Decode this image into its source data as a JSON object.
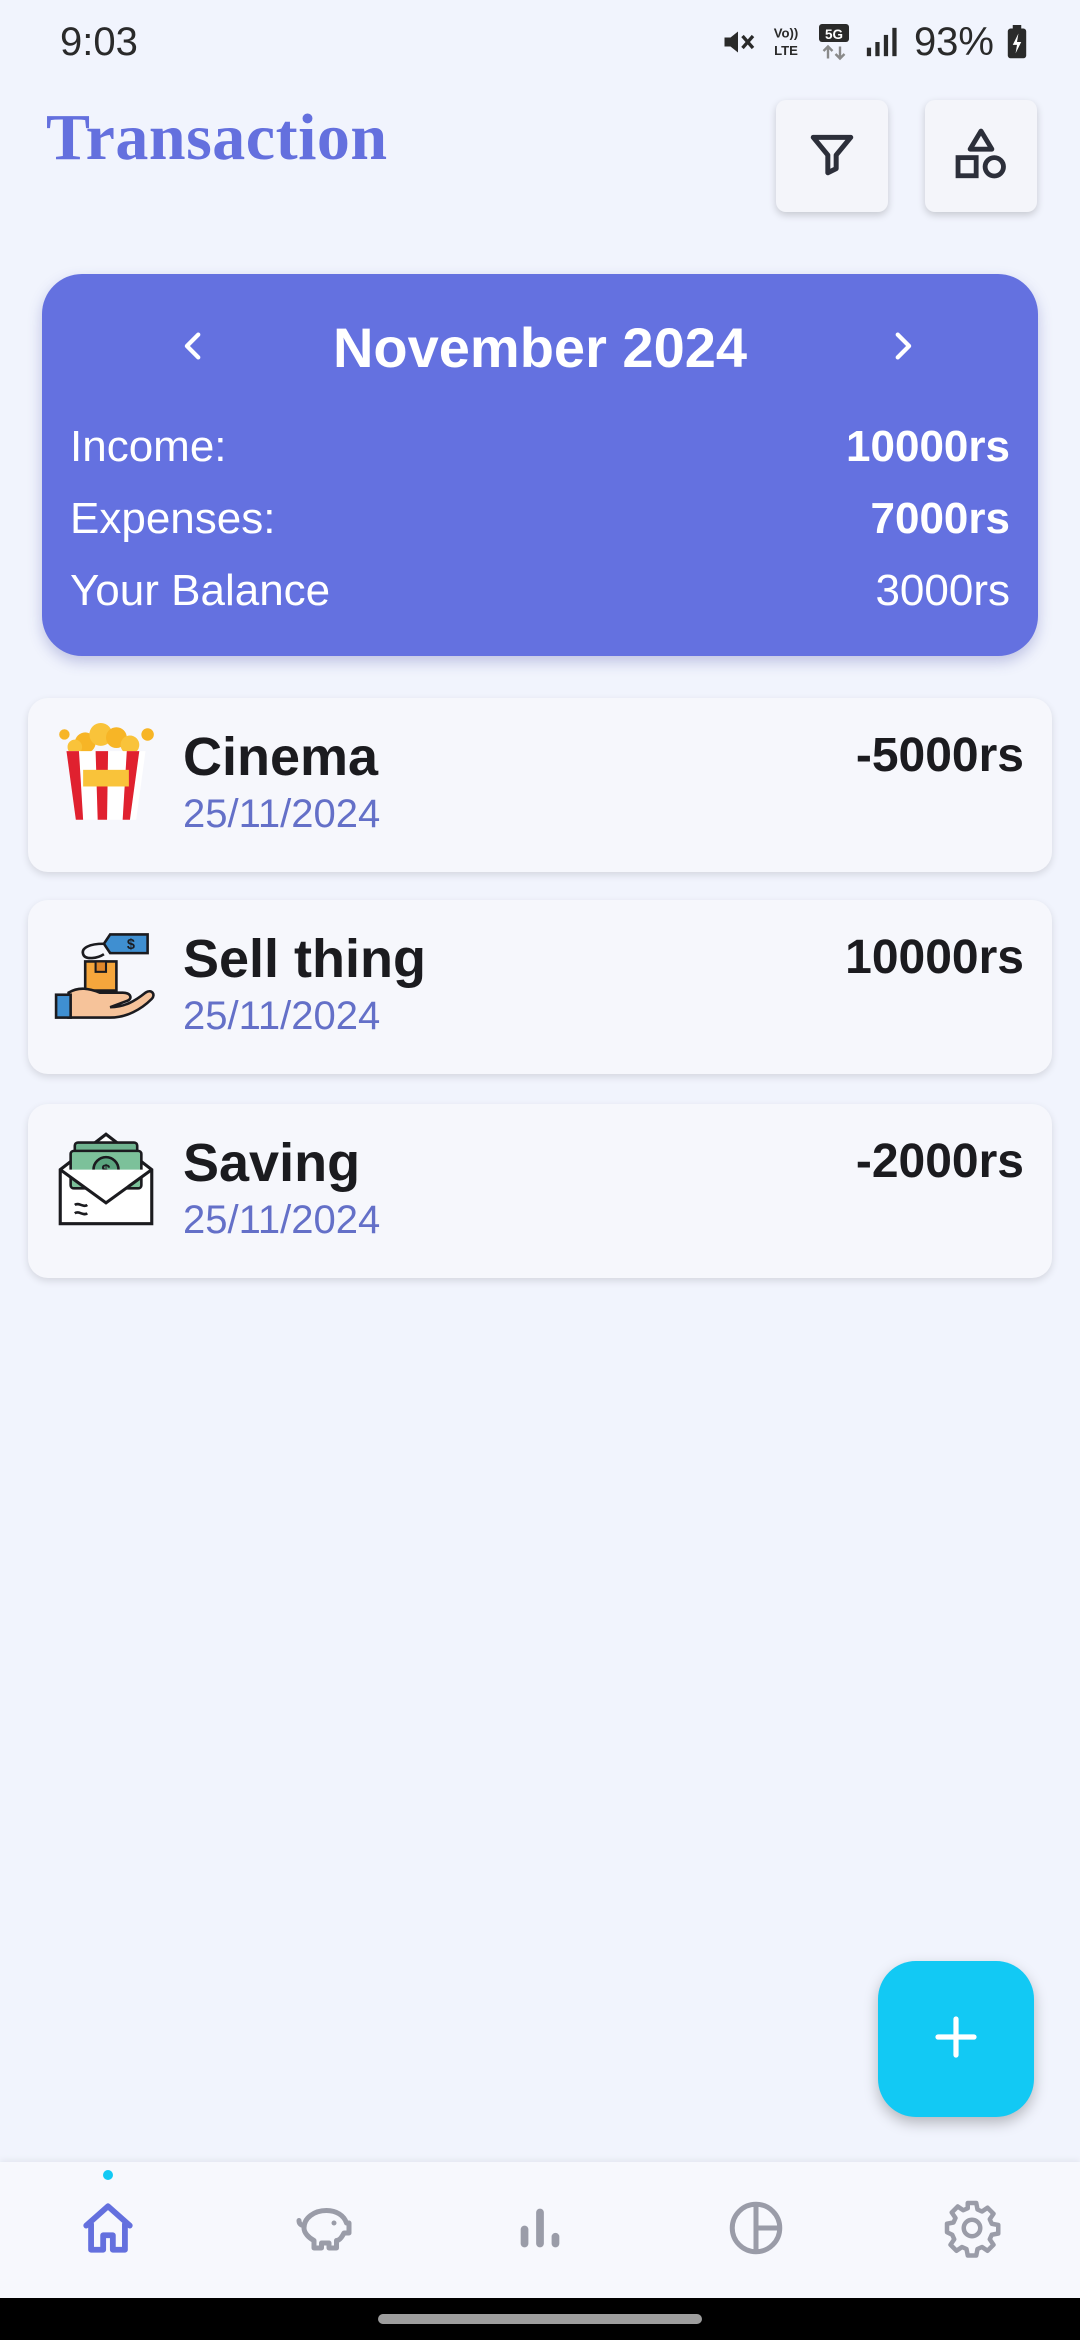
{
  "status_bar": {
    "time": "9:03",
    "battery": "93%",
    "icons": [
      "mute-icon",
      "volte-icon",
      "5g-icon",
      "signal-icon",
      "battery-icon"
    ]
  },
  "header": {
    "title": "Transaction",
    "filter_icon": "filter-icon",
    "shapes_icon": "shapes-icon"
  },
  "summary": {
    "month": "November 2024",
    "prev_icon": "chevron-left-icon",
    "next_icon": "chevron-right-icon",
    "income_label": "Income:",
    "income_value": "10000rs",
    "expenses_label": "Expenses:",
    "expenses_value": "7000rs",
    "balance_label": "Your Balance",
    "balance_value": "3000rs"
  },
  "transactions": [
    {
      "title": "Cinema",
      "date": "25/11/2024",
      "amount": "-5000rs",
      "icon": "popcorn-icon"
    },
    {
      "title": "Sell thing",
      "date": "25/11/2024",
      "amount": "10000rs",
      "icon": "sell-box-icon"
    },
    {
      "title": "Saving",
      "date": "25/11/2024",
      "amount": "-2000rs",
      "icon": "money-envelope-icon"
    }
  ],
  "fab_icon": "plus-icon",
  "bottom_nav": [
    {
      "icon": "home-icon",
      "active": true
    },
    {
      "icon": "piggy-bank-icon",
      "active": false
    },
    {
      "icon": "bar-chart-icon",
      "active": false
    },
    {
      "icon": "pie-chart-icon",
      "active": false
    },
    {
      "icon": "gear-icon",
      "active": false
    }
  ],
  "colors": {
    "accent": "#6471e0",
    "title": "#6470de",
    "fab": "#12c9f4",
    "background": "#f1f4fd"
  }
}
